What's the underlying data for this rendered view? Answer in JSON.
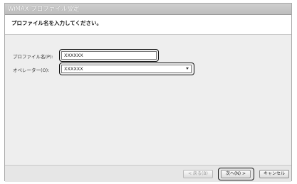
{
  "window": {
    "title": "WiMAX プロファイル設定"
  },
  "header": {
    "instruction": "プロファイル名を入力してください。"
  },
  "form": {
    "profile_name_label": "プロファイル名(P):",
    "profile_name_value": "XXXXXX",
    "operator_label": "オペレーター(O):",
    "operator_value": "XXXXXX"
  },
  "footer": {
    "back_label": "< 戻る(B)",
    "next_label": "次へ(N) >",
    "cancel_label": "キャンセル"
  }
}
